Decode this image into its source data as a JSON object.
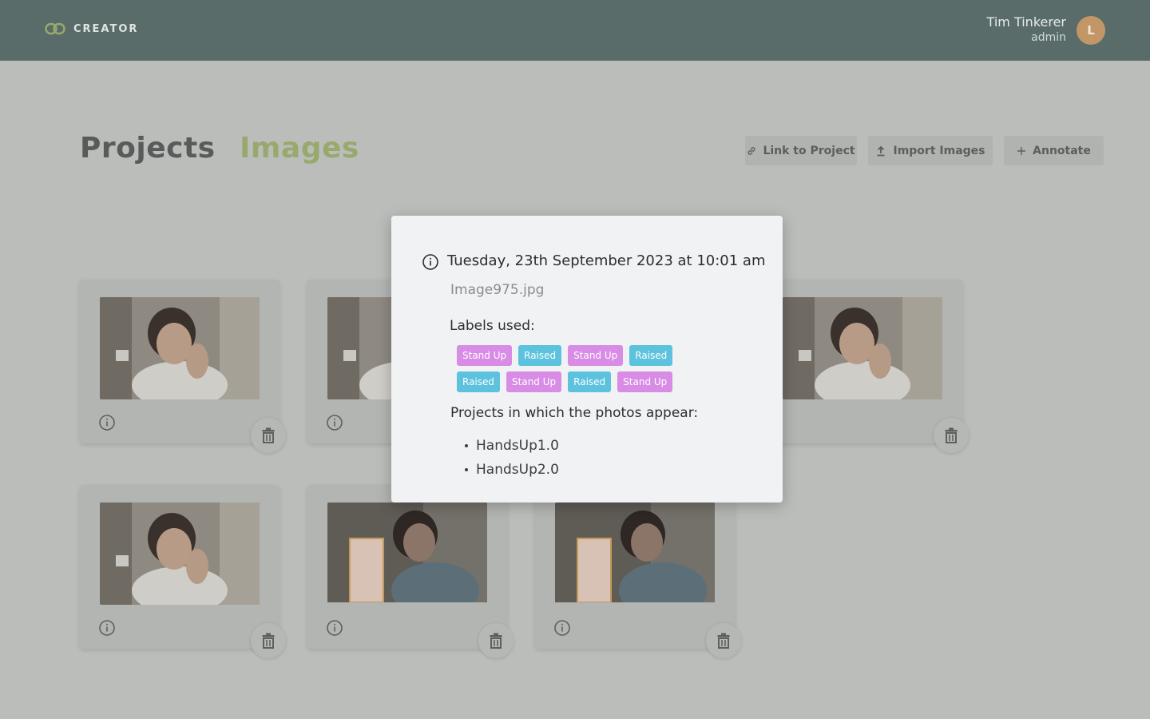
{
  "header": {
    "brand": "CREATOR",
    "brand_icon": "link-logo-icon",
    "user_name": "Tim Tinkerer",
    "user_role": "admin",
    "avatar_initial": "L"
  },
  "tabs": {
    "projects": "Projects",
    "images": "Images",
    "active": "Images"
  },
  "toolbar": {
    "link_label": "Link to Project",
    "import_label": "Import Images",
    "annotate_label": "Annotate"
  },
  "modal": {
    "date": "Tuesday, 23th September 2023 at 10:01 am",
    "filename": "Image975.jpg",
    "labels_title": "Labels used:",
    "labels": [
      {
        "text": "Stand Up",
        "color": "#d98ce6"
      },
      {
        "text": "Raised",
        "color": "#5cc2dd"
      },
      {
        "text": "Stand Up",
        "color": "#d98ce6"
      },
      {
        "text": "Raised",
        "color": "#5cc2dd"
      },
      {
        "text": "Raised",
        "color": "#5cc2dd"
      },
      {
        "text": "Stand Up",
        "color": "#d98ce6"
      },
      {
        "text": "Raised",
        "color": "#5cc2dd"
      },
      {
        "text": "Stand Up",
        "color": "#d98ce6"
      }
    ],
    "projects_title": "Projects in which the photos appear:",
    "projects": [
      "HandsUp1.0",
      "HandsUp2.0"
    ]
  },
  "colors": {
    "header_bg": "#596c6a",
    "accent_green": "#98a96e",
    "label_pink": "#d98ce6",
    "label_blue": "#5cc2dd"
  }
}
